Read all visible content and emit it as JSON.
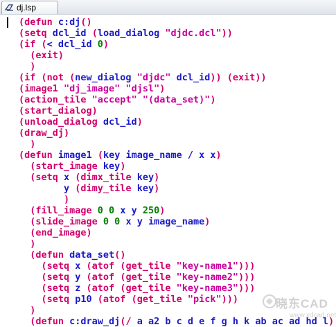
{
  "tab": {
    "title": "dj.lsp",
    "icon": "lisp-file-icon"
  },
  "lines": [
    [
      [
        "p",
        "(defun "
      ],
      [
        "k",
        "c:dj"
      ],
      [
        "p",
        "()"
      ]
    ],
    [
      [
        "p",
        "(setq "
      ],
      [
        "k",
        "dcl_id "
      ],
      [
        "p",
        "("
      ],
      [
        "k",
        "load_dialog "
      ],
      [
        "s",
        "\"djdc.dcl\""
      ],
      [
        "p",
        "))"
      ]
    ],
    [
      [
        "p",
        "(if ("
      ],
      [
        "k",
        "< dcl_id "
      ],
      [
        "n",
        "0"
      ],
      [
        "p",
        ")"
      ]
    ],
    [
      [
        "p",
        "  (exit)"
      ]
    ],
    [
      [
        "p",
        "  )"
      ]
    ],
    [
      [
        "p",
        "(if (not ("
      ],
      [
        "k",
        "new_dialog "
      ],
      [
        "s",
        "\"djdc\" "
      ],
      [
        "k",
        "dcl_id"
      ],
      [
        "p",
        ")) (exit))"
      ]
    ],
    [
      [
        "p",
        "(image1 "
      ],
      [
        "s",
        "\"dj_image\" \"djsl\""
      ],
      [
        "p",
        ")"
      ]
    ],
    [
      [
        "p",
        "(action_tile "
      ],
      [
        "s",
        "\"accept\" \"(data_set)\""
      ],
      [
        "p",
        ")"
      ]
    ],
    [
      [
        "p",
        "(start_dialog)"
      ]
    ],
    [
      [
        "p",
        "(unload_dialog "
      ],
      [
        "k",
        "dcl_id"
      ],
      [
        "p",
        ")"
      ]
    ],
    [
      [
        "p",
        "(draw_dj)"
      ]
    ],
    [
      [
        "p",
        "  )"
      ]
    ],
    [
      [
        "p",
        "(defun "
      ],
      [
        "k",
        "image1 "
      ],
      [
        "p",
        "("
      ],
      [
        "k",
        "key image_name / x x"
      ],
      [
        "p",
        ")"
      ]
    ],
    [
      [
        "p",
        "  (start_image "
      ],
      [
        "k",
        "key"
      ],
      [
        "p",
        ")"
      ]
    ],
    [
      [
        "p",
        "  (setq "
      ],
      [
        "k",
        "x "
      ],
      [
        "p",
        "(dimx_tile "
      ],
      [
        "k",
        "key"
      ],
      [
        "p",
        ")"
      ]
    ],
    [
      [
        "k",
        "        y "
      ],
      [
        "p",
        "(dimy_tile "
      ],
      [
        "k",
        "key"
      ],
      [
        "p",
        ")"
      ]
    ],
    [
      [
        "p",
        "        )"
      ]
    ],
    [
      [
        "p",
        "  (fill_image "
      ],
      [
        "n",
        "0 0 "
      ],
      [
        "k",
        "x y "
      ],
      [
        "n",
        "250"
      ],
      [
        "p",
        ")"
      ]
    ],
    [
      [
        "p",
        "  (slide_image "
      ],
      [
        "n",
        "0 0 "
      ],
      [
        "k",
        "x y image_name"
      ],
      [
        "p",
        ")"
      ]
    ],
    [
      [
        "p",
        "  (end_image)"
      ]
    ],
    [
      [
        "p",
        "  )"
      ]
    ],
    [
      [
        "p",
        "  (defun "
      ],
      [
        "k",
        "data_set"
      ],
      [
        "p",
        "()"
      ]
    ],
    [
      [
        "p",
        "    (setq "
      ],
      [
        "k",
        "x "
      ],
      [
        "p",
        "(atof (get_tile "
      ],
      [
        "s",
        "\"key-name1\""
      ],
      [
        "p",
        ")))"
      ]
    ],
    [
      [
        "p",
        "    (setq "
      ],
      [
        "k",
        "y "
      ],
      [
        "p",
        "(atof (get_tile "
      ],
      [
        "s",
        "\"key-name2\""
      ],
      [
        "p",
        ")))"
      ]
    ],
    [
      [
        "p",
        "    (setq "
      ],
      [
        "k",
        "z "
      ],
      [
        "p",
        "(atof (get_tile "
      ],
      [
        "s",
        "\"key-name3\""
      ],
      [
        "p",
        ")))"
      ]
    ],
    [
      [
        "p",
        "    (setq "
      ],
      [
        "k",
        "p10 "
      ],
      [
        "p",
        "(atof (get_tile "
      ],
      [
        "s",
        "\"pick\""
      ],
      [
        "p",
        ")))"
      ]
    ],
    [
      [
        "p",
        "  )"
      ]
    ],
    [
      [
        "p",
        "  (defun "
      ],
      [
        "k",
        "c:draw_dj"
      ],
      [
        "p",
        "(/ "
      ],
      [
        "k",
        "a a2 b c d e f g h k ab ac ad hd l"
      ],
      [
        "p",
        ")"
      ]
    ]
  ],
  "watermark": {
    "text": "晓东CAD",
    "subtext": "www.xdcad.net"
  },
  "colors": {
    "paren": "#d0006a",
    "keyword": "#1a1ac8",
    "string": "#c8009a",
    "number": "#008000"
  }
}
